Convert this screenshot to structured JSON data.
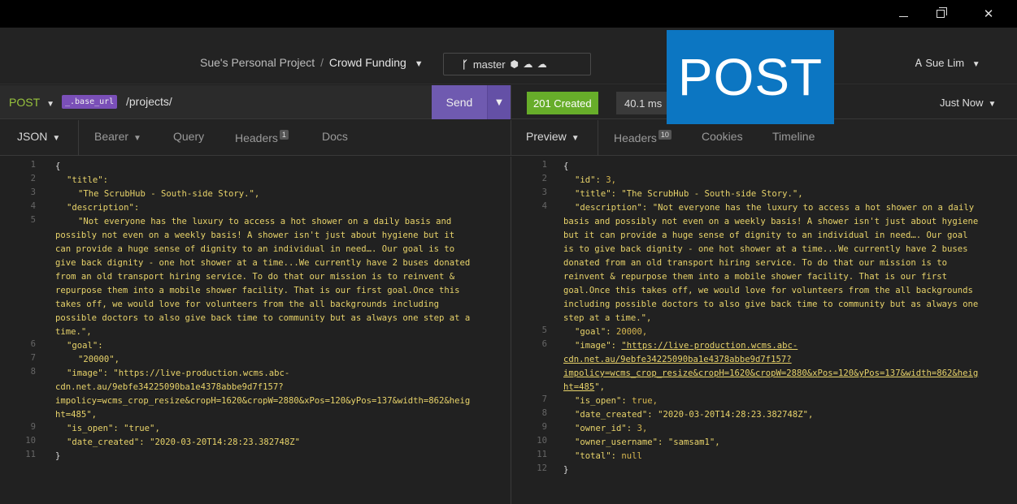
{
  "window": {
    "minimize_icon": "minimize-icon",
    "maximize_icon": "restore-icon",
    "close_label": "✕"
  },
  "header": {
    "project": "Sue's Personal Project",
    "separator": "/",
    "workspace": "Crowd Funding",
    "branch": "master",
    "user": "Sue Lim"
  },
  "overlay": {
    "label": "POST"
  },
  "request": {
    "method": "POST",
    "base_url_tag": "_.base_url",
    "path": "/projects/",
    "send_label": "Send"
  },
  "response": {
    "status": "201 Created",
    "time": "40.1 ms",
    "when": "Just Now"
  },
  "request_tabs": [
    {
      "label": "JSON"
    },
    {
      "label": "Bearer"
    },
    {
      "label": "Query"
    },
    {
      "label": "Headers",
      "badge": "1"
    },
    {
      "label": "Docs"
    }
  ],
  "response_tabs": [
    {
      "label": "Preview"
    },
    {
      "label": "Headers",
      "badge": "10"
    },
    {
      "label": "Cookies"
    },
    {
      "label": "Timeline"
    }
  ],
  "request_body": {
    "line_numbers": [
      "1",
      "2",
      "3",
      "4",
      "5",
      "6",
      "7",
      "8",
      "9",
      "10",
      "11"
    ],
    "open": "{",
    "title_key": "\"title\":",
    "title_val": "\"The ScrubHub - South-side Story.\",",
    "desc_key": "\"description\":",
    "desc_lines": [
      "\"Not everyone has the luxury to access a hot shower on a daily basis and",
      "possibly not even on a weekly basis! A shower isn't just about hygiene but it",
      "can provide a huge sense of dignity to an individual in need…. Our goal is to",
      "give back dignity - one hot shower at a time...We currently have 2 buses donated",
      "from an old transport hiring service. To do that our mission is to reinvent &",
      "repurpose them into a mobile shower facility. That is our first goal.Once this",
      "takes off, we would love for volunteers from the all backgrounds including",
      "possible doctors to also give back time to community but as always one step at a",
      "time.\","
    ],
    "goal_key": "\"goal\":",
    "goal_val": "\"20000\",",
    "image_key": "\"image\":",
    "image_lines": [
      "\"https://live-production.wcms.abc-",
      "cdn.net.au/9ebfe34225090ba1e4378abbe9d7f157?",
      "impolicy=wcms_crop_resize&cropH=1620&cropW=2880&xPos=120&yPos=137&width=862&heig",
      "ht=485\","
    ],
    "is_open_key": "\"is_open\":",
    "is_open_val": "\"true\",",
    "date_key": "\"date_created\":",
    "date_val": "\"2020-03-20T14:28:23.382748Z\"",
    "close": "}"
  },
  "response_body": {
    "line_numbers": [
      "1",
      "2",
      "3",
      "4",
      "5",
      "6",
      "7",
      "8",
      "9",
      "10",
      "11",
      "12"
    ],
    "open": "{",
    "id_key": "\"id\":",
    "id_val": "3,",
    "title_key": "\"title\":",
    "title_val": "\"The ScrubHub - South-side Story.\",",
    "desc_key": "\"description\":",
    "desc_first": "\"Not everyone has the luxury to access a hot shower on a daily",
    "desc_lines": [
      "basis and possibly not even on a weekly basis! A shower isn't just about hygiene",
      "but it can provide a huge sense of dignity to an individual in need…. Our goal",
      "is to give back dignity - one hot shower at a time...We currently have 2 buses",
      "donated from an old transport hiring service. To do that our mission is to",
      "reinvent & repurpose them into a mobile shower facility. That is our first",
      "goal.Once this takes off, we would love for volunteers from the all backgrounds",
      "including possible doctors to also give back time to community but as always one",
      "step at a time.\","
    ],
    "goal_key": "\"goal\":",
    "goal_val": "20000,",
    "image_key": "\"image\":",
    "image_first": "\"https://live-production.wcms.abc-",
    "image_lines": [
      "cdn.net.au/9ebfe34225090ba1e4378abbe9d7f157?",
      "impolicy=wcms_crop_resize&cropH=1620&cropW=2880&xPos=120&yPos=137&width=862&heig",
      "ht=485"
    ],
    "image_tail": "\",",
    "is_open_key": "\"is_open\":",
    "is_open_val": "true,",
    "date_key": "\"date_created\":",
    "date_val": "\"2020-03-20T14:28:23.382748Z\",",
    "owner_id_key": "\"owner_id\":",
    "owner_id_val": "3,",
    "owner_user_key": "\"owner_username\":",
    "owner_user_val": "\"samsam1\",",
    "total_key": "\"total\":",
    "total_val": "null",
    "close": "}"
  },
  "colors": {
    "method": "#98c33d",
    "status_ok": "#67ad2a",
    "send": "#6f5ab0",
    "overlay": "#0c76c2",
    "json_string": "#e8d36a"
  }
}
